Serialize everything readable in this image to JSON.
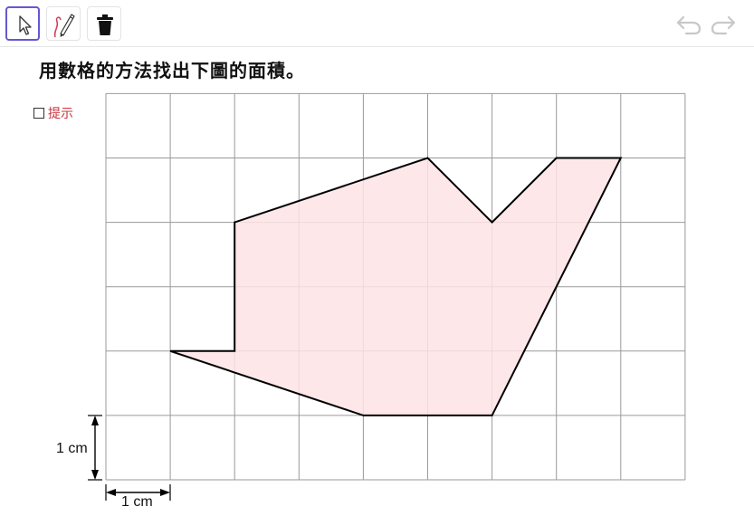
{
  "toolbar": {
    "tools": [
      {
        "name": "move-tool",
        "icon": "arrow-pointer-icon",
        "active": true
      },
      {
        "name": "pen-tool",
        "icon": "pen-icon",
        "active": false
      },
      {
        "name": "delete-tool",
        "icon": "trash-icon",
        "active": false
      }
    ],
    "undo_icon": "undo-icon",
    "redo_icon": "redo-icon",
    "accent_color": "#6557d2"
  },
  "question": {
    "title": "用數格的方法找出下圖的面積。"
  },
  "hint": {
    "label": "提示",
    "checked": false,
    "color": "#c8323c"
  },
  "grid": {
    "columns": 9,
    "rows": 6,
    "line_color": "#9a9a9a"
  },
  "shape": {
    "fill_color": "#fde3e5",
    "stroke_color": "#000000",
    "vertices": [
      [
        1,
        2
      ],
      [
        2,
        2
      ],
      [
        2,
        4
      ],
      [
        5,
        5
      ],
      [
        6,
        4
      ],
      [
        7,
        5
      ],
      [
        8,
        5
      ],
      [
        6,
        1
      ],
      [
        4,
        1
      ]
    ]
  },
  "dimensions": {
    "vertical_label": "1 cm",
    "horizontal_label": "1 cm"
  }
}
